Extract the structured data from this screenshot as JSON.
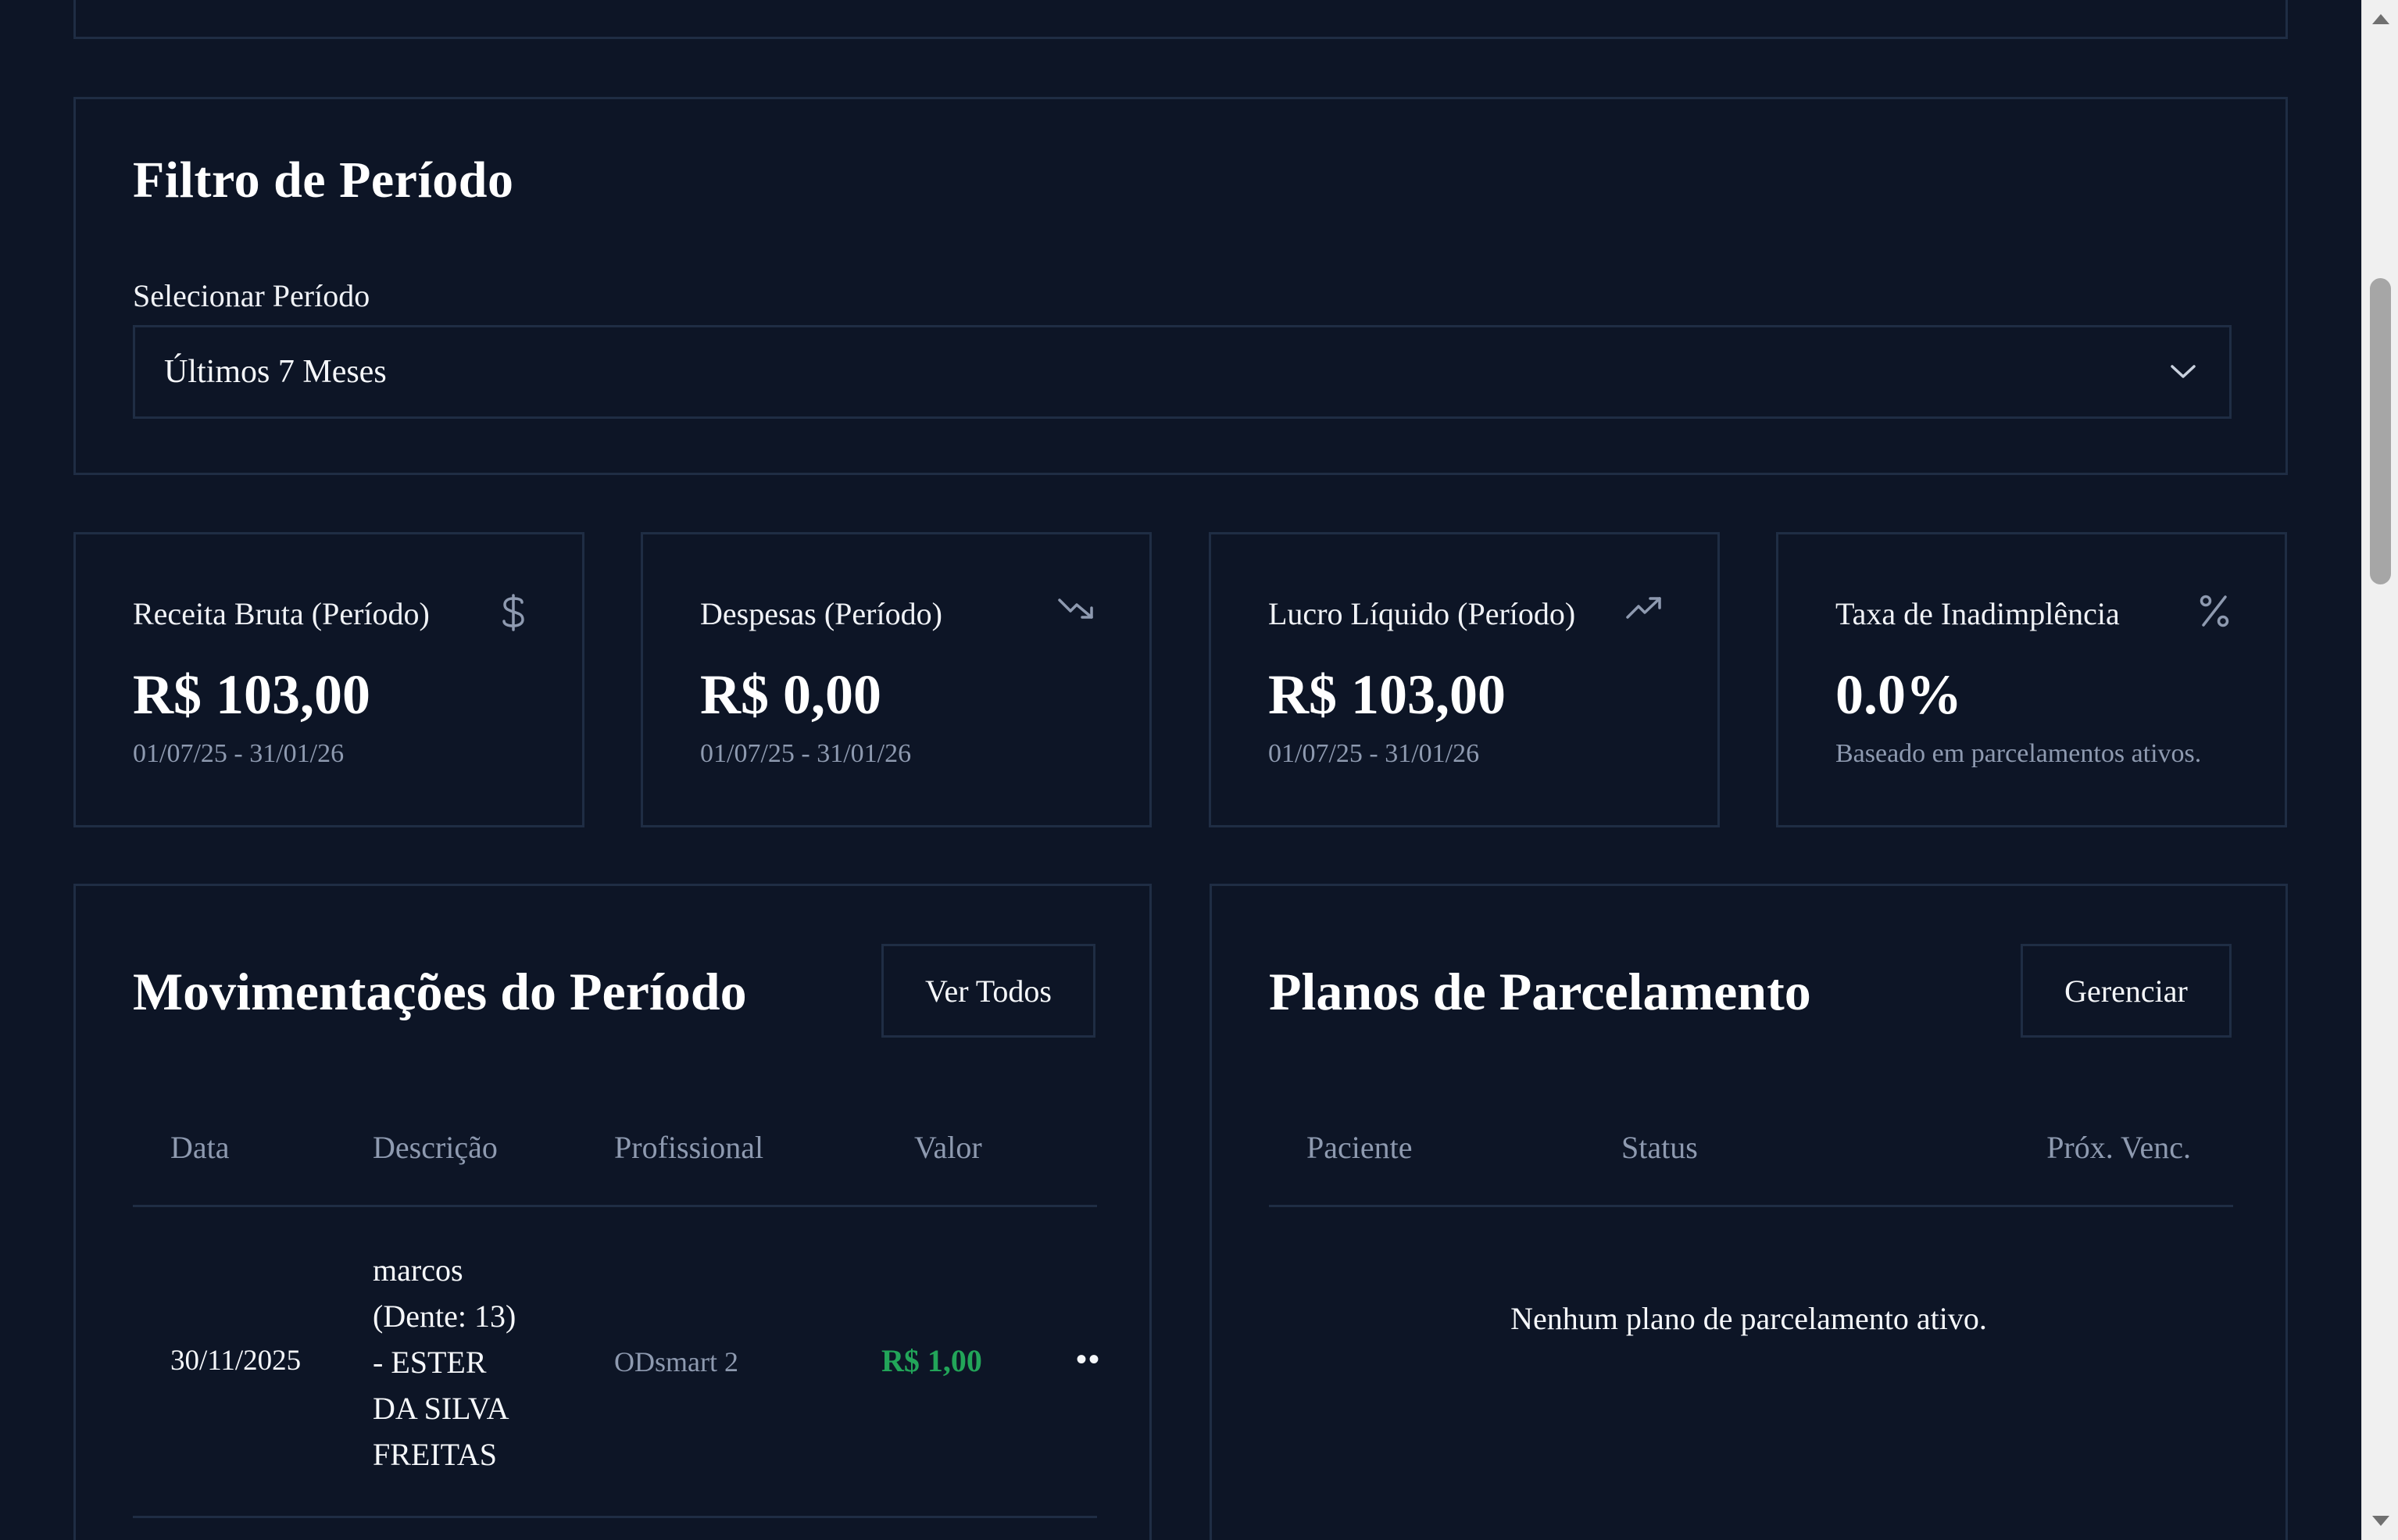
{
  "filter": {
    "title": "Filtro de Período",
    "label": "Selecionar Período",
    "selected": "Últimos 7 Meses"
  },
  "stats": [
    {
      "label": "Receita Bruta (Período)",
      "value": "R$ 103,00",
      "sub": "01/07/25 - 31/01/26",
      "icon": "dollar-icon"
    },
    {
      "label": "Despesas (Período)",
      "value": "R$ 0,00",
      "sub": "01/07/25 - 31/01/26",
      "icon": "trending-down-icon"
    },
    {
      "label": "Lucro Líquido (Período)",
      "value": "R$ 103,00",
      "sub": "01/07/25 - 31/01/26",
      "icon": "trending-up-icon"
    },
    {
      "label": "Taxa de Inadimplência",
      "value": "0.0%",
      "sub": "Baseado em parcelamentos ativos.",
      "icon": "percent-icon"
    }
  ],
  "movimentacoes": {
    "title": "Movimentações do Período",
    "button": "Ver Todos",
    "columns": [
      "Data",
      "Descrição",
      "Profissional",
      "Valor"
    ],
    "rows": [
      {
        "data": "30/11/2025",
        "descricao_lines": [
          "marcos",
          "(Dente: 13)",
          "- ESTER",
          "DA SILVA",
          "FREITAS"
        ],
        "profissional": "ODsmart 2",
        "valor": "R$ 1,00",
        "actions": "••"
      }
    ]
  },
  "planos": {
    "title": "Planos de Parcelamento",
    "button": "Gerenciar",
    "columns": [
      "Paciente",
      "Status",
      "Próx. Venc."
    ],
    "empty": "Nenhum plano de parcelamento ativo."
  },
  "colors": {
    "background": "#0d1526",
    "border": "#1f2d44",
    "muted": "#8e9ab0",
    "positive": "#22a559"
  }
}
